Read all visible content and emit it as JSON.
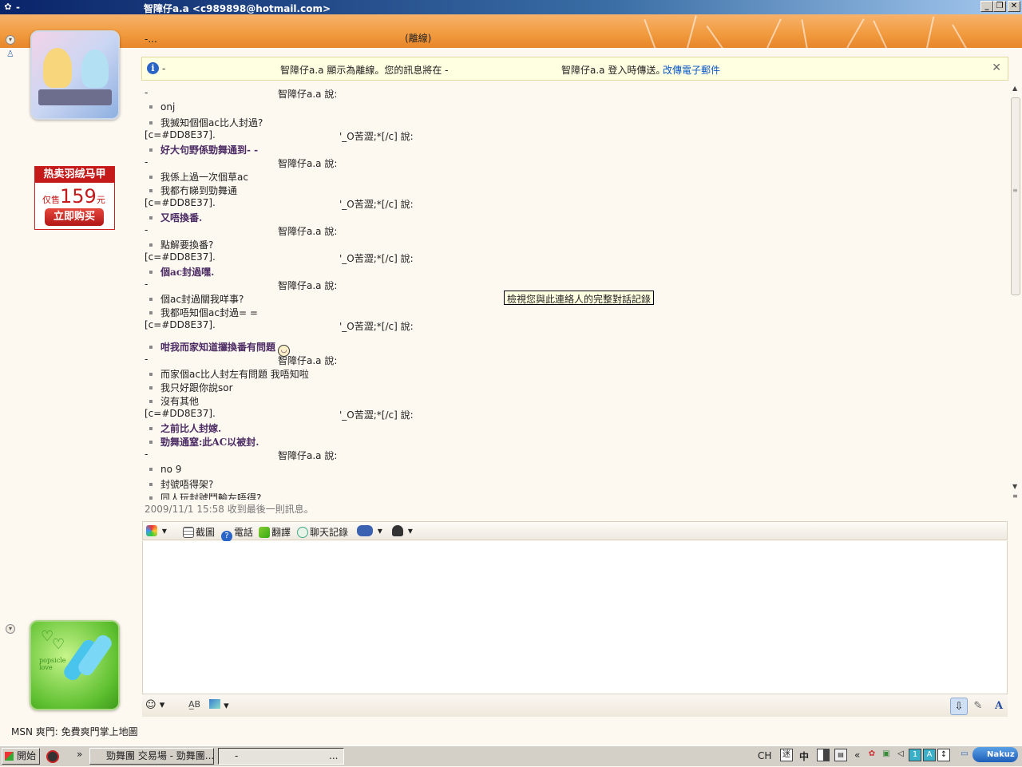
{
  "window": {
    "title": "智障仔a.a <c989898@hotmail.com>",
    "title_prefix": "-",
    "min_label": "_",
    "restore_label": "❐",
    "close_label": "✕"
  },
  "header": {
    "contact_name": "-...",
    "status": "(離線)"
  },
  "ad": {
    "title": "热卖羽绒马甲",
    "price_prefix": "仅售",
    "price": "159",
    "price_unit": "元",
    "buy_label": "立即购买"
  },
  "infobar": {
    "dash": "-",
    "text_part1": "智障仔a.a 顯示為離線。您的訊息將在 -",
    "text_part2": "智障仔a.a 登入時傳送。",
    "link": "改傳電子郵件"
  },
  "chat": {
    "messages": [
      {
        "type": "sender",
        "who": "a",
        "prefix": "-",
        "name": "智障仔a.a 說:"
      },
      {
        "type": "line",
        "text": "onj"
      },
      {
        "type": "line",
        "text": "我搣知個個ac比人封過?"
      },
      {
        "type": "sender",
        "who": "b",
        "prefix": "[c=#DD8E37].",
        "name": "'_O苦澀;*[/c] 說:"
      },
      {
        "type": "bold",
        "text": "好大句野係勁舞通到- -"
      },
      {
        "type": "sender",
        "who": "a",
        "prefix": "-",
        "name": "智障仔a.a 說:"
      },
      {
        "type": "line",
        "text": "我係上過一次個草ac"
      },
      {
        "type": "line",
        "text": "我都冇睇到勁舞通"
      },
      {
        "type": "sender",
        "who": "b",
        "prefix": "[c=#DD8E37].",
        "name": "'_O苦澀;*[/c] 說:"
      },
      {
        "type": "bold",
        "text": "又唔換番."
      },
      {
        "type": "sender",
        "who": "a",
        "prefix": "-",
        "name": "智障仔a.a 說:"
      },
      {
        "type": "line",
        "text": "點解要換番?"
      },
      {
        "type": "sender",
        "who": "b",
        "prefix": "[c=#DD8E37].",
        "name": "'_O苦澀;*[/c] 說:"
      },
      {
        "type": "bold",
        "text": "個ac封過嘿."
      },
      {
        "type": "sender",
        "who": "a",
        "prefix": "-",
        "name": "智障仔a.a 說:"
      },
      {
        "type": "line",
        "text": "個ac封過關我咩事?"
      },
      {
        "type": "line",
        "text": "我都唔知個ac封過= ="
      },
      {
        "type": "sender",
        "who": "b",
        "prefix": "[c=#DD8E37].",
        "name": "'_O苦澀;*[/c] 說:"
      },
      {
        "type": "bold",
        "text": "咁我而家知道攞換番有問題",
        "emoticon": "sleepy-emoticon"
      },
      {
        "type": "sender",
        "who": "a",
        "prefix": "-",
        "name": "智障仔a.a 說:"
      },
      {
        "type": "line",
        "text": "而家個ac比人封左有問題  我唔知啦"
      },
      {
        "type": "line",
        "text": "我只好跟你說sor"
      },
      {
        "type": "line",
        "text": "沒有其他"
      },
      {
        "type": "sender",
        "who": "b",
        "prefix": "[c=#DD8E37].",
        "name": "'_O苦澀;*[/c] 說:"
      },
      {
        "type": "bold",
        "text": "之前比人封嫁."
      },
      {
        "type": "bold",
        "text": "勁舞通窒:此AC以被封."
      },
      {
        "type": "sender",
        "who": "a",
        "prefix": "-",
        "name": "智障仔a.a 說:"
      },
      {
        "type": "line",
        "text": "no 9"
      },
      {
        "type": "line",
        "text": "封號唔得架?"
      },
      {
        "type": "line",
        "text": "同人玩封號鬥輸左唔得?"
      }
    ],
    "tooltip": "檢視您與此連絡人的完整對話記錄",
    "last_received": "2009/11/1 15:58 收到最後一則訊息。"
  },
  "compose": {
    "toolbar": {
      "screenshot_label": "截圖",
      "call_label": "電話",
      "translate_label": "翻譯",
      "history_label": "聊天記錄"
    }
  },
  "footer": {
    "msn_ad": "MSN 爽門: 免費爽門掌上地圖"
  },
  "taskbar": {
    "start_label": "開始",
    "chevron": "»",
    "tasks": [
      "勁舞團 交易場 - 勁舞團...",
      "-"
    ],
    "task2_suffix": "...",
    "tray": {
      "lang": "CH",
      "ime_label": "中",
      "tray_chevron": "«",
      "box1": "1",
      "box2": "A",
      "brand": "Nakuz"
    }
  },
  "colors": {
    "header_orange": "#f19a3e",
    "info_yellow": "#ffffe1",
    "link_blue": "#0b57c8",
    "bold_msg": "#4b2b63"
  }
}
